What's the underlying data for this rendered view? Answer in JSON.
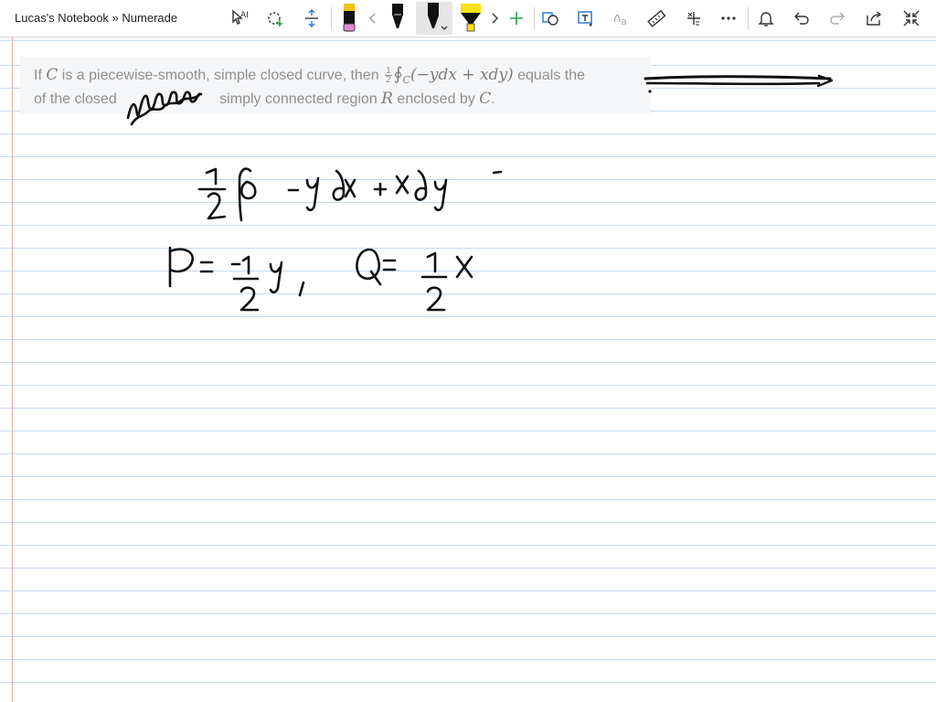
{
  "window": {
    "title": "Lucas's Notebook » Numerade"
  },
  "toolbar": {
    "tools": [
      {
        "name": "lasso-select-tool"
      },
      {
        "name": "add-shape-tool"
      },
      {
        "name": "add-space-tool"
      },
      {
        "name": "pen-pink"
      },
      {
        "name": "scroll-left"
      },
      {
        "name": "pen-black-fine"
      },
      {
        "name": "pen-black-active"
      },
      {
        "name": "highlighter-yellow"
      },
      {
        "name": "scroll-right"
      },
      {
        "name": "add-pen"
      },
      {
        "name": "ink-to-shape"
      },
      {
        "name": "ink-to-text"
      },
      {
        "name": "ink-to-math"
      },
      {
        "name": "ruler"
      },
      {
        "name": "math"
      },
      {
        "name": "more"
      }
    ],
    "right_tools": [
      {
        "name": "notifications"
      },
      {
        "name": "undo"
      },
      {
        "name": "redo"
      },
      {
        "name": "share"
      },
      {
        "name": "fullscreen"
      }
    ],
    "colors": {
      "pink": "#e08ad0",
      "black": "#111111",
      "yellow": "#f6e21a",
      "accent": "#2f7fd6"
    }
  },
  "question": {
    "line1_prefix": "If ",
    "var_C": "C",
    "line1_mid": " is a piecewise-smooth, simple closed curve, then ",
    "frac_num": "1",
    "frac_den": "2",
    "integral_symbol": "∮",
    "integral_sub": "C",
    "integrand": "(−ydx + xdy)",
    "line1_suffix": " equals the",
    "line2_prefix": "of the closed",
    "line2_mid": " simply connected region ",
    "var_R": "R",
    "line2_after": " enclosed by ",
    "var_C2": "C",
    "line2_end": "."
  },
  "handwriting": {
    "line1": "1/2 ∮ -ydx + xdy  -",
    "line2": "P = -1/2 y ,   Q = 1/2 x"
  }
}
